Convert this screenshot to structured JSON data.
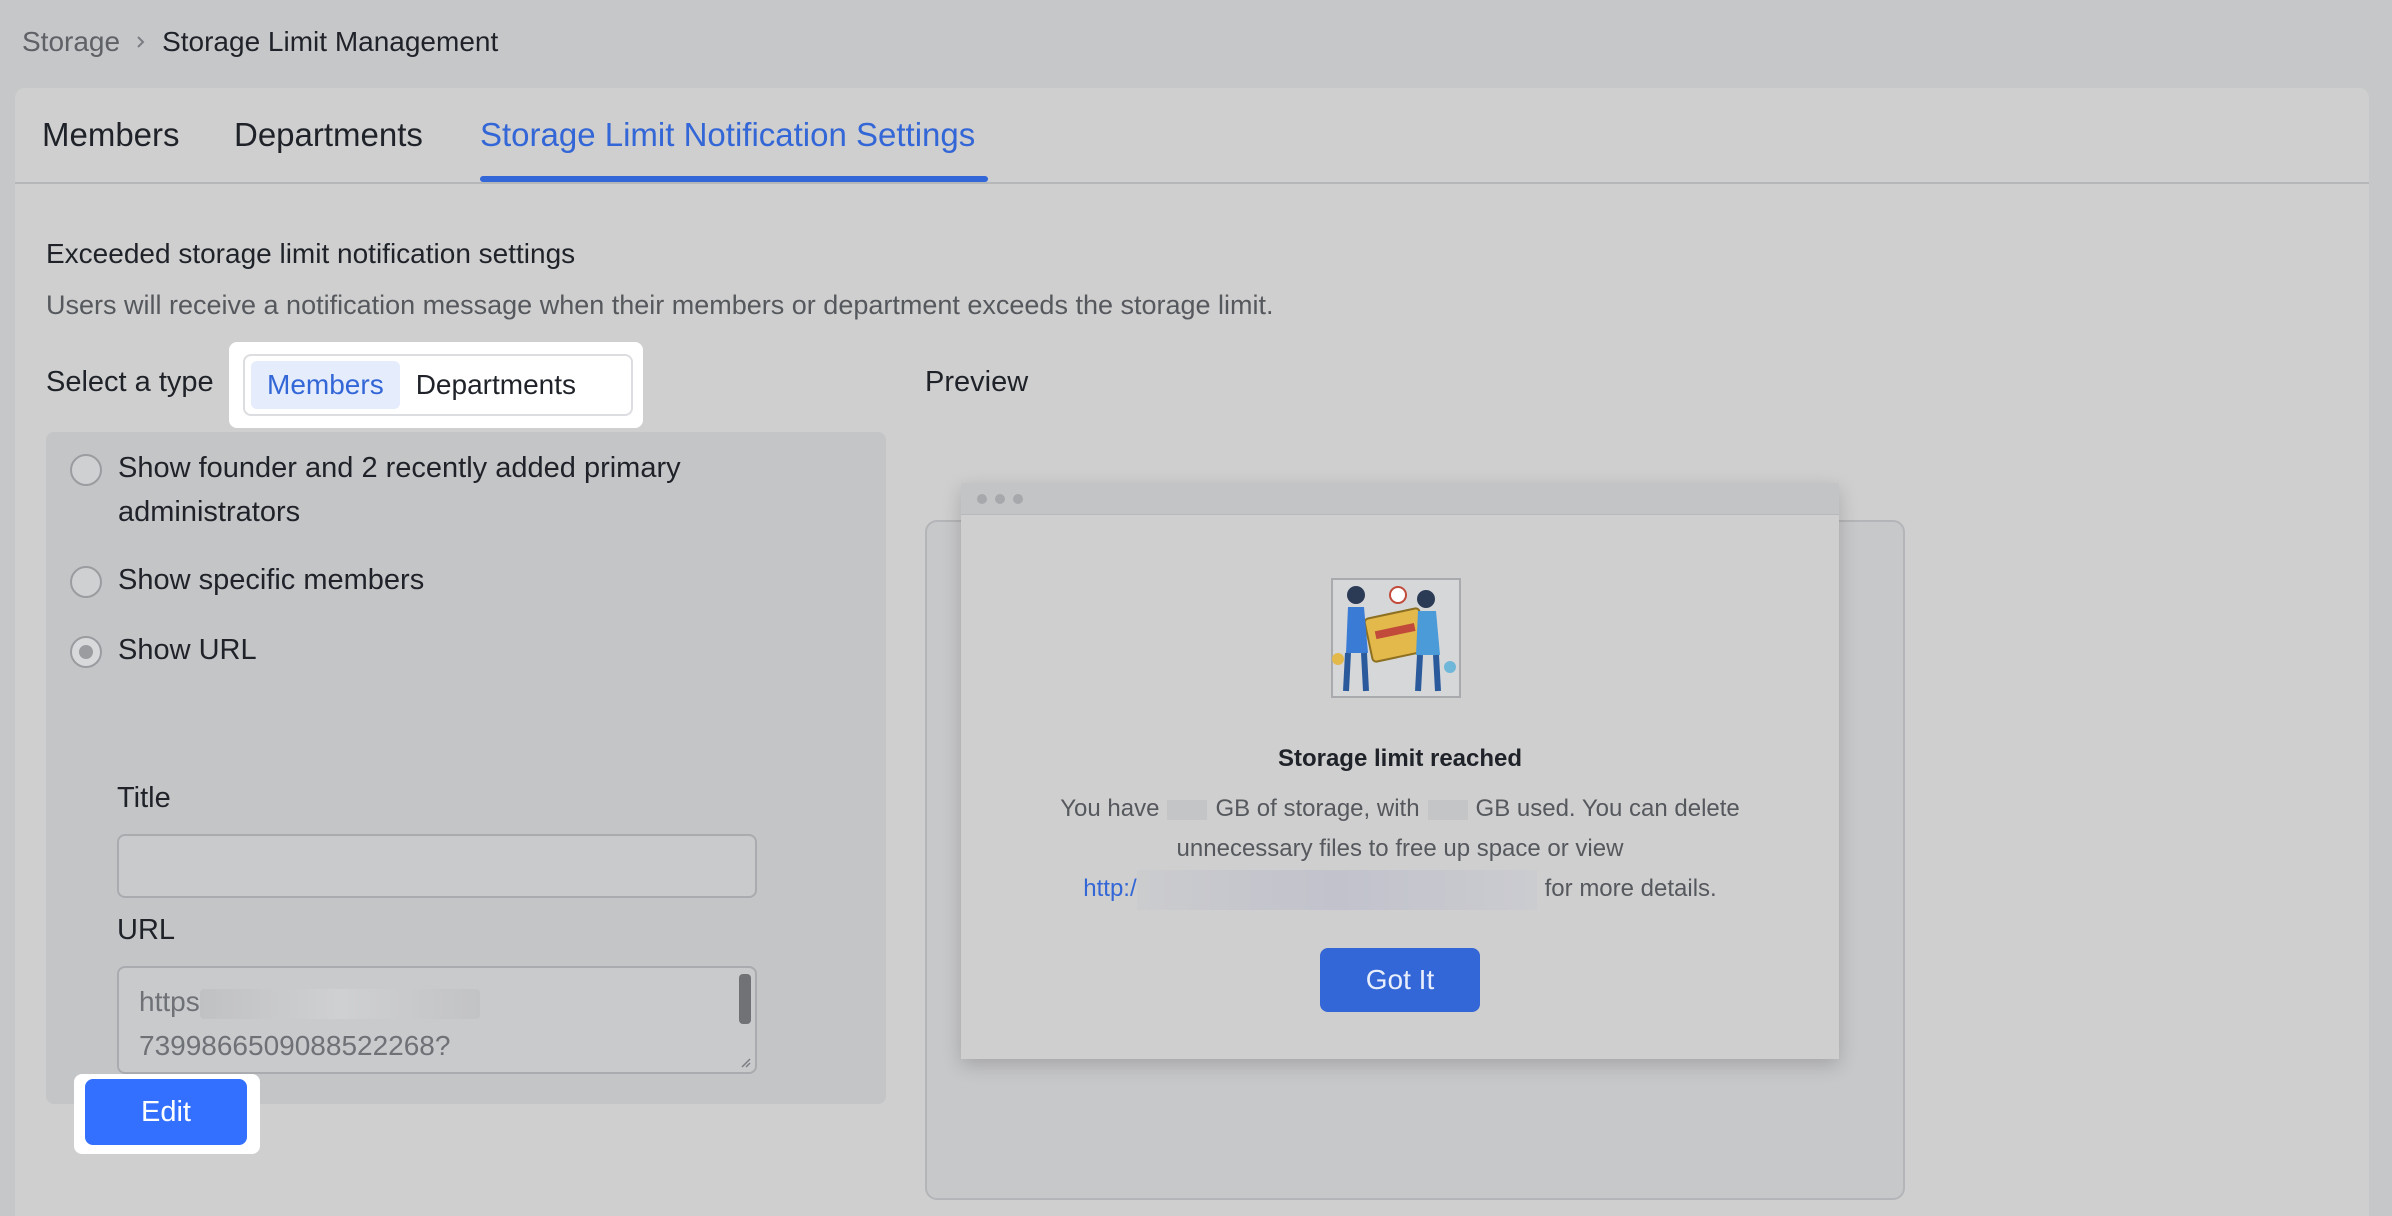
{
  "breadcrumb": {
    "root": "Storage",
    "current": "Storage Limit Management"
  },
  "tabs": [
    {
      "label": "Members"
    },
    {
      "label": "Departments"
    },
    {
      "label": "Storage Limit Notification Settings",
      "active": true
    }
  ],
  "section": {
    "title": "Exceeded storage limit notification settings",
    "description": "Users will receive a notification message when their members or department exceeds the storage limit."
  },
  "type_select": {
    "label": "Select a type",
    "options": [
      "Members",
      "Departments"
    ],
    "selected": "Members"
  },
  "options": [
    {
      "label": "Show founder and 2 recently added primary administrators",
      "checked": false
    },
    {
      "label": "Show specific members",
      "checked": false
    },
    {
      "label": "Show URL",
      "checked": true
    }
  ],
  "url_form": {
    "title_label": "Title",
    "title_value": "",
    "url_label": "URL",
    "url_line1": "https",
    "url_line2": "7399866509088522268?"
  },
  "edit_button": "Edit",
  "preview": {
    "label": "Preview",
    "notice_title": "Storage limit reached",
    "body_part1": "You have",
    "body_part2": "GB of storage, with",
    "body_part3": "GB used. You can delete unnecessary files to free up space or view",
    "link_prefix": "http:/",
    "body_part4": "for more details.",
    "button": "Got It"
  },
  "colors": {
    "accent": "#3366d6",
    "primary_button": "#3370ff",
    "background": "#c6c7c9"
  },
  "icons": [
    "chevron-right-icon",
    "storage-illustration"
  ]
}
